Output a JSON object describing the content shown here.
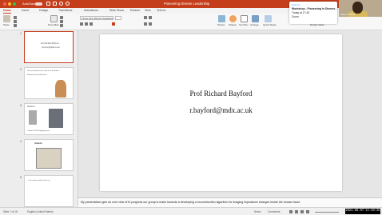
{
  "titlebar": {
    "autosave": "AutoSave",
    "doc_title": "Pioneering Diverse Leadership"
  },
  "ribbon_tabs": [
    "Home",
    "Insert",
    "Design",
    "Transitions",
    "Animations",
    "Slide Show",
    "Review",
    "View",
    "Tell me"
  ],
  "ribbon": {
    "paste": "Paste",
    "new_slide": "New Slide",
    "font_name": "Times New Roman (Headings)",
    "picture": "Picture",
    "shapes": "Shapes",
    "text_box": "Text Box",
    "arrange": "Arrange",
    "quick_styles": "Quick Styles",
    "designer": "Design Ideas"
  },
  "thumbnails": [
    {
      "num": "1",
      "lines": [
        "Prof Richard Bayford",
        "r.bayford@mdx.ac.uk"
      ]
    },
    {
      "num": "2",
      "lines": [
        "Who you spend to take a pic in the Institution",
        "Identity and team/influences"
      ]
    },
    {
      "num": "3",
      "lines": [
        "Research",
        "Control of EIT imaging systems"
      ]
    },
    {
      "num": "4",
      "lines": [
        "Setbacks"
      ]
    },
    {
      "num": "5",
      "lines": [
        "Current future path and success"
      ]
    }
  ],
  "slide": {
    "name": "Prof Richard Bayford",
    "email": "r.bayford@mdx.ac.uk"
  },
  "notes": "My presentation give an over view of th progress our group is make towards a developing a reconstruction algorithm for imaging impedance changes inside the human head.",
  "statusbar": {
    "slide_count": "Slide 1 of 18",
    "language": "English (United States)",
    "notes": "Notes",
    "comments": "Comments",
    "timestamp": "2021-09-07 11:40:35"
  },
  "notification": {
    "app": "zoom.us",
    "title": "Workshop - Pioneering in Diverse...",
    "time": "Today at 17:40",
    "source": "Zoom"
  },
  "video": {
    "participant_name": "Sharon Lindsay"
  },
  "colors": {
    "accent": "#c43e1c",
    "zoom_blue": "#2d8cff"
  }
}
